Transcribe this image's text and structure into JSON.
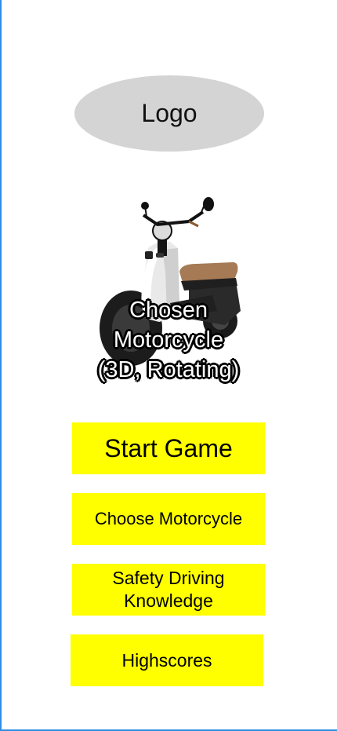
{
  "logo": {
    "label": "Logo"
  },
  "motorcycle_preview": {
    "caption": "Chosen\nMotorcycle\n(3D, Rotating)",
    "image_icon": "scooter-image"
  },
  "menu": {
    "start_game": "Start Game",
    "choose_motorcycle": "Choose Motorcycle",
    "safety_driving": "Safety Driving\nKnowledge",
    "highscores": "Highscores"
  },
  "colors": {
    "button_background": "#ffff00",
    "logo_background": "#d4d4d4",
    "frame_border": "#2f8de4"
  }
}
